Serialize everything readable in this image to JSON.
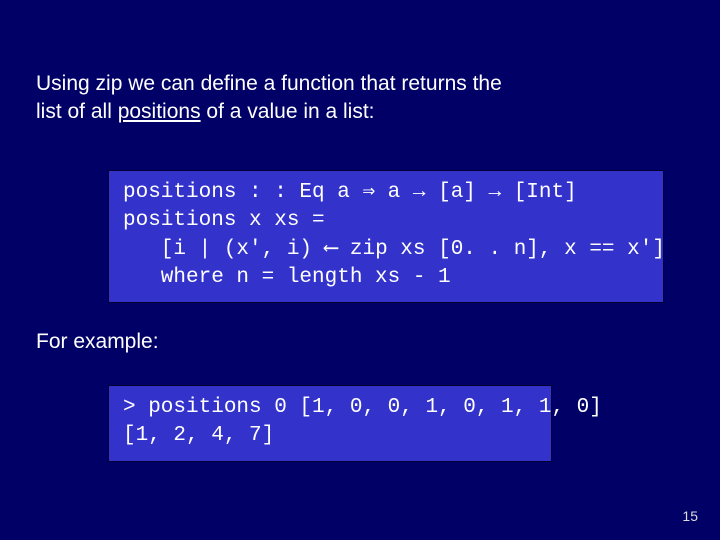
{
  "intro": {
    "line1": "Using zip we can define a function that returns the",
    "line2_pre": "list of all ",
    "line2_u": "positions",
    "line2_post": " of a value in a list:"
  },
  "code1": {
    "l1": "positions : : Eq a ⇒ a → [a] → [Int]",
    "l2": "positions x xs =",
    "l3": "   [i | (x', i) ⟵ zip xs [0. . n], x == x']",
    "l4": "   where n = length xs - 1"
  },
  "for_example": "For example:",
  "code2": {
    "l1": "> positions 0 [1, 0, 0, 1, 0, 1, 1, 0]",
    "l2": "[1, 2, 4, 7]"
  },
  "page": "15"
}
